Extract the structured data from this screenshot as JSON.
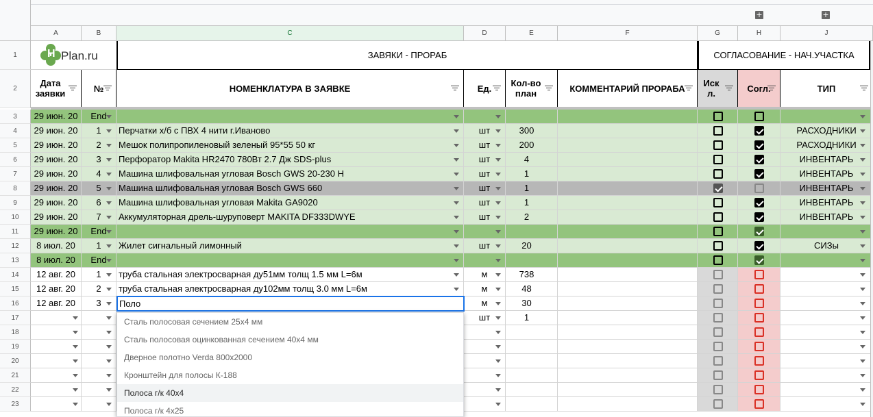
{
  "columns": [
    "A",
    "B",
    "C",
    "D",
    "E",
    "F",
    "G",
    "H",
    "J"
  ],
  "row_numbers": [
    "1",
    "2",
    "3",
    "4",
    "5",
    "6",
    "7",
    "8",
    "9",
    "10",
    "11",
    "12",
    "13",
    "14",
    "15",
    "16",
    "17",
    "18",
    "19",
    "20",
    "21",
    "22",
    "23"
  ],
  "logo": {
    "text": "Plan.ru",
    "mark": "H"
  },
  "title_left": "ЗАВЯКИ - ПРОРАБ",
  "title_right": "СОГЛАСОВАНИЕ - НАЧ.УЧАСТКА",
  "headers": {
    "date": "Дата заявки",
    "num": "№",
    "nomenclature": "НОМЕНКЛАТУРА В ЗАЯВКЕ",
    "unit": "Ед.",
    "qty": "Кол-во план",
    "comment": "КОММЕНТАРИЙ ПРОРАБА",
    "excl": "Иск л.",
    "approve": "Согл.",
    "type": "ТИП"
  },
  "rows": [
    {
      "date": "29 июн. 20",
      "num": "End",
      "name": "",
      "unit": "",
      "qty": "",
      "excl": false,
      "approve": false,
      "type": "",
      "style": "green"
    },
    {
      "date": "29 июн. 20",
      "num": "1",
      "name": "Перчатки х/б с ПВХ 4 нити г.Иваново",
      "unit": "шт",
      "qty": "300",
      "excl": false,
      "approve": true,
      "type": "РАСХОДНИКИ",
      "style": "light"
    },
    {
      "date": "29 июн. 20",
      "num": "2",
      "name": "Мешок полипропиленовый зеленый 95*55 50 кг",
      "unit": "шт",
      "qty": "200",
      "excl": false,
      "approve": true,
      "type": "РАСХОДНИКИ",
      "style": "light"
    },
    {
      "date": "29 июн. 20",
      "num": "3",
      "name": "Перфоратор Makita HR2470 780Вт 2.7 Дж SDS-plus",
      "unit": "шт",
      "qty": "4",
      "excl": false,
      "approve": true,
      "type": "ИНВЕНТАРЬ",
      "style": "light"
    },
    {
      "date": "29 июн. 20",
      "num": "4",
      "name": "Машина шлифовальная угловая Bosch GWS 20-230 H",
      "unit": "шт",
      "qty": "1",
      "excl": false,
      "approve": true,
      "type": "ИНВЕНТАРЬ",
      "style": "light"
    },
    {
      "date": "29 июн. 20",
      "num": "5",
      "name": "Машина шлифовальная угловая Bosch GWS 660",
      "unit": "шт",
      "qty": "1",
      "excl": true,
      "approve": false,
      "type": "ИНВЕНТАРЬ",
      "style": "grey"
    },
    {
      "date": "29 июн. 20",
      "num": "6",
      "name": "Машина шлифовальная угловая Makita GA9020",
      "unit": "шт",
      "qty": "1",
      "excl": false,
      "approve": true,
      "type": "ИНВЕНТАРЬ",
      "style": "light"
    },
    {
      "date": "29 июн. 20",
      "num": "7",
      "name": "Аккумуляторная дрель-шуруповерт MAKITA DF333DWYE",
      "unit": "шт",
      "qty": "2",
      "excl": false,
      "approve": true,
      "type": "ИНВЕНТАРЬ",
      "style": "light"
    },
    {
      "date": "29 июн. 20",
      "num": "End",
      "name": "",
      "unit": "",
      "qty": "",
      "excl": false,
      "approve": true,
      "type": "",
      "style": "green"
    },
    {
      "date": "8 июл. 20",
      "num": "1",
      "name": "Жилет сигнальный лимонный",
      "unit": "шт",
      "qty": "20",
      "excl": false,
      "approve": true,
      "type": "СИЗы",
      "style": "light"
    },
    {
      "date": "8 июл. 20",
      "num": "End",
      "name": "",
      "unit": "",
      "qty": "",
      "excl": false,
      "approve": true,
      "type": "",
      "style": "green"
    },
    {
      "date": "12 авг. 20",
      "num": "1",
      "name": "труба стальная электросварная ду51мм толщ 1.5 мм L=6м",
      "unit": "м",
      "qty": "738",
      "excl": false,
      "approve": false,
      "type": "",
      "style": "white"
    },
    {
      "date": "12 авг. 20",
      "num": "2",
      "name": "труба стальная электросварная ду102мм толщ 3.0 мм L=6м",
      "unit": "м",
      "qty": "48",
      "excl": false,
      "approve": false,
      "type": "",
      "style": "white"
    },
    {
      "date": "12 авг. 20",
      "num": "3",
      "name": "Поло",
      "unit": "м",
      "qty": "30",
      "excl": false,
      "approve": false,
      "type": "",
      "style": "white"
    },
    {
      "date": "",
      "num": "",
      "name": "",
      "unit": "шт",
      "qty": "1",
      "excl": false,
      "approve": false,
      "type": "",
      "style": "white"
    },
    {
      "date": "",
      "num": "",
      "name": "",
      "unit": "",
      "qty": "",
      "excl": false,
      "approve": false,
      "type": "",
      "style": "white"
    },
    {
      "date": "",
      "num": "",
      "name": "",
      "unit": "",
      "qty": "",
      "excl": false,
      "approve": false,
      "type": "",
      "style": "white"
    },
    {
      "date": "",
      "num": "",
      "name": "",
      "unit": "",
      "qty": "",
      "excl": false,
      "approve": false,
      "type": "",
      "style": "white"
    },
    {
      "date": "",
      "num": "",
      "name": "",
      "unit": "",
      "qty": "",
      "excl": false,
      "approve": false,
      "type": "",
      "style": "white"
    },
    {
      "date": "",
      "num": "",
      "name": "",
      "unit": "",
      "qty": "",
      "excl": false,
      "approve": false,
      "type": "",
      "style": "white"
    },
    {
      "date": "",
      "num": "",
      "name": "",
      "unit": "",
      "qty": "",
      "excl": false,
      "approve": false,
      "type": "",
      "style": "white"
    }
  ],
  "suggestions": [
    "Сталь полосовая сечением 25х4 мм",
    "Сталь полосовая оцинкованная сечением 40х4 мм",
    "Дверное полотно Verda 800х2000",
    "Кронштейн для полосы К-188",
    "Полоса г/к 40х4",
    "Полоса г/к 4х25"
  ],
  "highlighted_suggestion": 4,
  "colors": {
    "green_row": "#93c47d",
    "light_row": "#d9ead3",
    "grey_row": "#b7b7b7",
    "excl_col": "#d9d9d9",
    "approve_col": "#f4cccc",
    "accent": "#1a73e8"
  }
}
